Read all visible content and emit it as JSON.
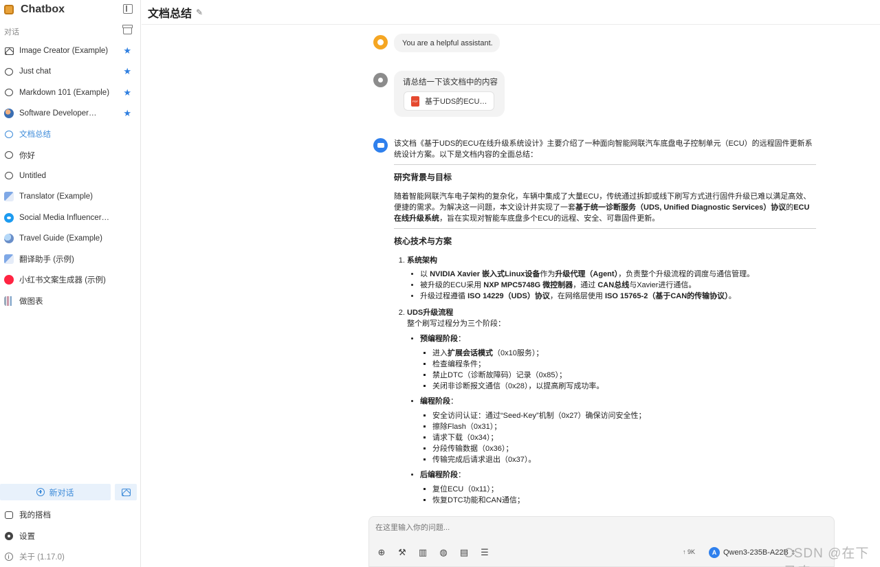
{
  "app": {
    "name": "Chatbox"
  },
  "sidebar": {
    "section_label": "对话",
    "conversations": [
      {
        "label": "Image Creator (Example)",
        "icon": "image-icon",
        "starred": true
      },
      {
        "label": "Just chat",
        "icon": "chat-bubble-icon",
        "starred": true
      },
      {
        "label": "Markdown 101 (Example)",
        "icon": "chat-bubble-icon",
        "starred": true
      },
      {
        "label": "Software Developer…",
        "icon": "developer-avatar",
        "starred": true
      },
      {
        "label": "文档总结",
        "icon": "chat-bubble-icon",
        "active": true
      },
      {
        "label": "你好",
        "icon": "chat-bubble-icon"
      },
      {
        "label": "Untitled",
        "icon": "chat-bubble-icon"
      },
      {
        "label": "Translator (Example)",
        "icon": "translator-avatar"
      },
      {
        "label": "Social Media Influencer…",
        "icon": "twitter-avatar"
      },
      {
        "label": "Travel Guide (Example)",
        "icon": "globe-avatar"
      },
      {
        "label": "翻译助手 (示例)",
        "icon": "translator-avatar"
      },
      {
        "label": "小红书文案生成器 (示例)",
        "icon": "xiaohongshu-avatar"
      },
      {
        "label": "做图表",
        "icon": "chart-avatar"
      }
    ],
    "new_chat": "新对话",
    "my_copilots": "我的搭档",
    "settings": "设置",
    "about": "关于 (1.17.0)"
  },
  "main": {
    "title": "文档总结",
    "system_message": "You are a helpful assistant.",
    "user_message": "请总结一下该文档中的内容",
    "attachment": "基于UDS的ECU…",
    "answer": {
      "intro": "该文档《基于UDS的ECU在线升级系统设计》主要介绍了一种面向智能网联汽车底盘电子控制单元（ECU）的远程固件更新系统设计方案。以下是文档内容的全面总结：",
      "h1": "研究背景与目标",
      "p1_a": "随着智能网联汽车电子架构的复杂化，车辆中集成了大量ECU，传统通过拆卸或线下刷写方式进行固件升级已难以满足高效、便捷的需求。为解决这一问题，本文设计并实现了一套",
      "p1_b": "基于统一诊断服务（UDS, Unified Diagnostic Services）协议",
      "p1_c": "的",
      "p1_d": "ECU在线升级系统",
      "p1_e": "，旨在实现对智能车底盘多个ECU的远程、安全、可靠固件更新。",
      "h2": "核心技术与方案",
      "s1_title": "系统架构",
      "s1_b1_a": "以 ",
      "s1_b1_b": "NVIDIA Xavier 嵌入式Linux设备",
      "s1_b1_c": "作为",
      "s1_b1_d": "升级代理（Agent）",
      "s1_b1_e": "，负责整个升级流程的调度与通信管理。",
      "s1_b2_a": "被升级的ECU采用 ",
      "s1_b2_b": "NXP MPC5748G 微控制器",
      "s1_b2_c": "，通过 ",
      "s1_b2_d": "CAN总线",
      "s1_b2_e": "与Xavier进行通信。",
      "s1_b3_a": "升级过程遵循 ",
      "s1_b3_b": "ISO 14229（UDS）协议",
      "s1_b3_c": "，在网络层使用 ",
      "s1_b3_d": "ISO 15765-2（基于CAN的传输协议）",
      "s1_b3_e": "。",
      "s2_title": "UDS升级流程",
      "s2_desc": "整个刷写过程分为三个阶段：",
      "stage1": "预编程阶段",
      "stage1_items_a": "进入",
      "stage1_items_b": "扩展会话模式",
      "stage1_items_c": "（0x10服务）；",
      "stage1_items": [
        "检查编程条件；",
        "禁止DTC（诊断故障码）记录（0x85）；",
        "关闭非诊断报文通信（0x28），以提高刷写成功率。"
      ],
      "stage2": "编程阶段",
      "stage2_items": [
        "安全访问认证：通过“Seed-Key”机制（0x27）确保访问安全性；",
        "擦除Flash（0x31）；",
        "请求下载（0x34）；",
        "分段传输数据（0x36）；",
        "传输完成后请求退出（0x37）。"
      ],
      "stage3": "后编程阶段",
      "stage3_items": [
        "复位ECU（0x11）；",
        "恢复DTC功能和CAN通信；"
      ]
    }
  },
  "input": {
    "placeholder": "在这里输入你的问题...",
    "token_count": "↑ 9K",
    "model_badge": "A",
    "model": "Qwen3-235B-A22B"
  },
  "watermark": "CSDN @在下马农",
  "colors": {
    "accent": "#3d8bd9",
    "star": "#2f7fe0",
    "system_avatar": "#f5a623",
    "bot_avatar": "#2f80ed"
  }
}
